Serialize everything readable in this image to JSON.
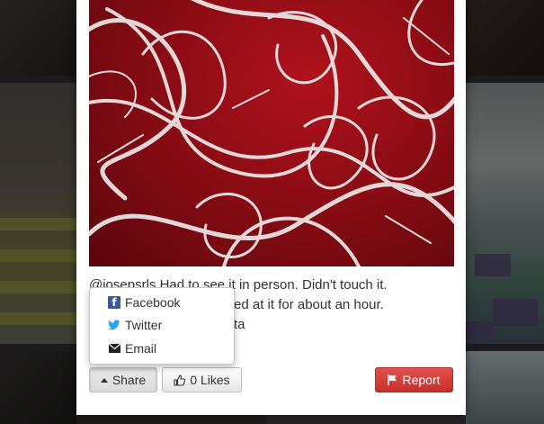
{
  "caption": {
    "line1": "@josepsrls Had to see it in person. Didn't touch it.",
    "line2": "ed at it for about an hour.",
    "line3": "ta"
  },
  "share_menu": {
    "items": [
      {
        "label": "Facebook",
        "icon": "facebook-icon"
      },
      {
        "label": "Twitter",
        "icon": "twitter-icon"
      },
      {
        "label": "Email",
        "icon": "email-icon"
      }
    ]
  },
  "toolbar": {
    "share_label": "Share",
    "likes_label": "0 Likes",
    "report_label": "Report"
  },
  "colors": {
    "report_button": "#d63a33",
    "facebook_blue": "#3b5998",
    "twitter_blue": "#2aa3ef",
    "photo_red": "#a5101a"
  }
}
